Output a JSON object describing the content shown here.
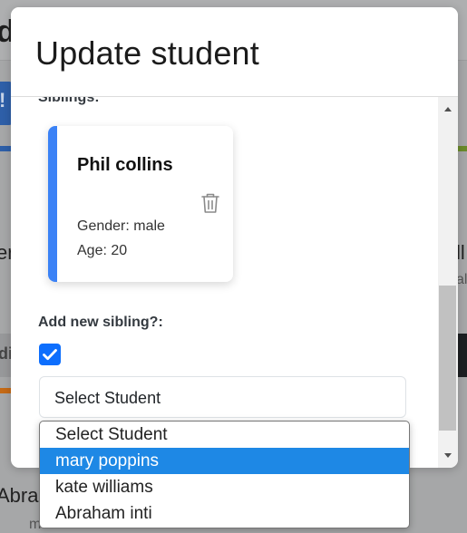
{
  "background": {
    "title_fragment": "d",
    "blue_button_fragment": "!",
    "left_text_fragment": "er",
    "right_text_fragment": "ll",
    "right_subtext_fragment": "al",
    "left_tab_fragment": "di",
    "bottom_name_fragment": "Abraha",
    "bottom_gender_fragment": "male"
  },
  "modal": {
    "title": "Update student",
    "siblings_label": "Siblings:",
    "sibling": {
      "name": "Phil collins",
      "gender": "Gender: male",
      "age": "Age: 20",
      "delete_icon": "trash-icon"
    },
    "add_sibling_label": "Add new sibling?:",
    "add_sibling_checked": true,
    "select": {
      "value": "Select Student"
    }
  },
  "dropdown": {
    "options": [
      {
        "label": "Select Student",
        "selected": false
      },
      {
        "label": "mary poppins",
        "selected": true
      },
      {
        "label": "kate williams",
        "selected": false
      },
      {
        "label": "Abraham inti",
        "selected": false
      }
    ]
  },
  "colors": {
    "accent": "#3b82f6",
    "checkbox": "#0d6efd",
    "highlight": "#1e88e5"
  }
}
